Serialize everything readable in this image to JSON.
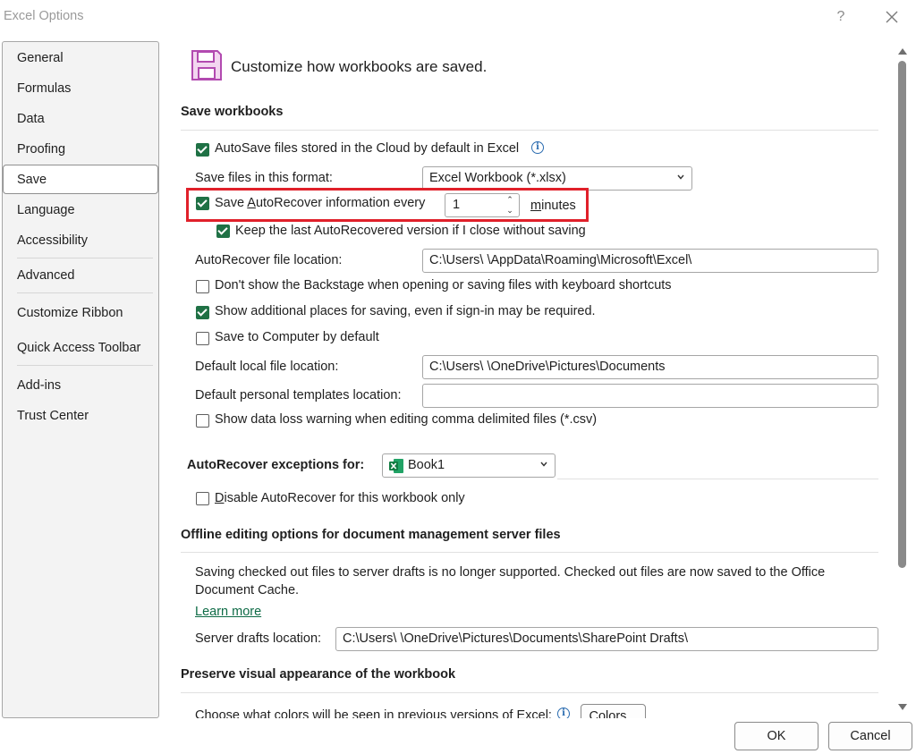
{
  "window": {
    "title": "Excel Options",
    "help": "?"
  },
  "sidebar": {
    "items": [
      {
        "label": "General"
      },
      {
        "label": "Formulas"
      },
      {
        "label": "Data"
      },
      {
        "label": "Proofing"
      },
      {
        "label": "Save",
        "selected": true
      },
      {
        "label": "Language"
      },
      {
        "label": "Accessibility"
      },
      {
        "label": "Advanced"
      },
      {
        "label": "Customize Ribbon"
      },
      {
        "label": "Quick Access Toolbar"
      },
      {
        "label": "Add-ins"
      },
      {
        "label": "Trust Center"
      }
    ]
  },
  "header": {
    "text": "Customize how workbooks are saved."
  },
  "save_workbooks": {
    "title": "Save workbooks",
    "autosave": {
      "label": "AutoSave files stored in the Cloud by default in Excel",
      "checked": true
    },
    "format": {
      "label": "Save files in this format:",
      "value": "Excel Workbook (*.xlsx)"
    },
    "autorecover": {
      "label": "Save AutoRecover information every",
      "checked": true,
      "value": "1",
      "unit": "minutes"
    },
    "keep_last": {
      "label": "Keep the last AutoRecovered version if I close without saving",
      "checked": true
    },
    "ar_location": {
      "label": "AutoRecover file location:",
      "value": "C:\\Users\\         \\AppData\\Roaming\\Microsoft\\Excel\\"
    },
    "no_backstage": {
      "label": "Don't show the Backstage when opening or saving files with keyboard shortcuts",
      "checked": false
    },
    "additional_places": {
      "label": "Show additional places for saving, even if sign-in may be required.",
      "checked": true
    },
    "save_to_computer": {
      "label": "Save to Computer by default",
      "checked": false
    },
    "local_location": {
      "label": "Default local file location:",
      "value": "C:\\Users\\        \\OneDrive\\Pictures\\Documents"
    },
    "templates_location": {
      "label": "Default personal templates location:",
      "value": ""
    },
    "csv_warning": {
      "label": "Show data loss warning when editing comma delimited files (*.csv)",
      "checked": false
    }
  },
  "exceptions": {
    "label": "AutoRecover exceptions for:",
    "workbook": "Book1",
    "disable": {
      "label": "Disable AutoRecover for this workbook only",
      "checked": false
    }
  },
  "offline": {
    "title": "Offline editing options for document management server files",
    "text_line1": "Saving checked out files to server drafts is no longer supported. Checked out files are now saved to the Office",
    "text_line2": "Document Cache.",
    "learn_more": "Learn more",
    "drafts": {
      "label": "Server drafts location:",
      "value": "C:\\Users\\        \\OneDrive\\Pictures\\Documents\\SharePoint Drafts\\"
    }
  },
  "preserve": {
    "title": "Preserve visual appearance of the workbook",
    "colors_text": "Choose what colors will be seen in previous versions of Excel:",
    "colors_button": "Colors..."
  },
  "footer": {
    "ok": "OK",
    "cancel": "Cancel"
  },
  "colors": {
    "accent_green": "#1f7145",
    "highlight_red": "#e0202a",
    "link": "#0e6b46"
  }
}
